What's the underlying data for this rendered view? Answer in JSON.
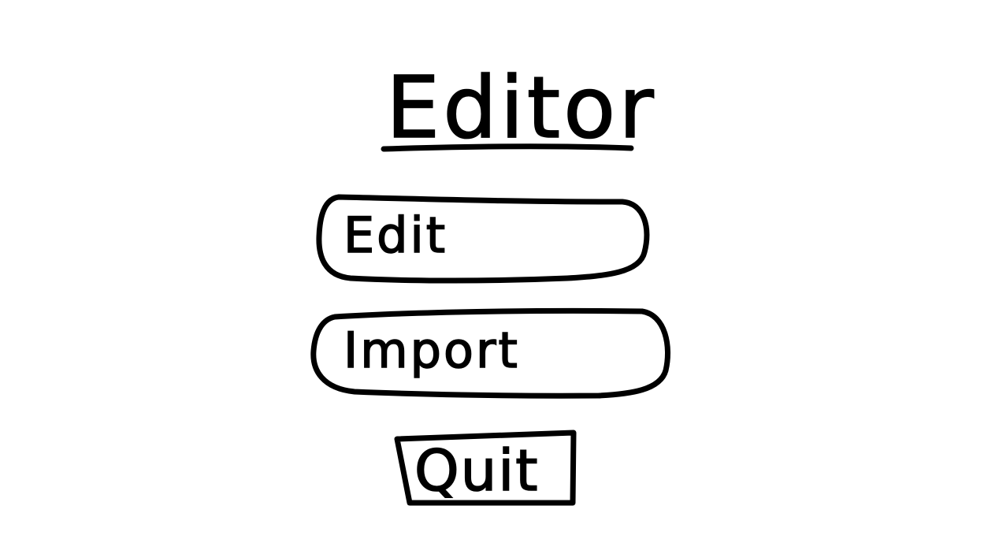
{
  "header": {
    "title": "Editor"
  },
  "menu": {
    "edit_label": "Edit",
    "import_label": "Import",
    "quit_label": "Quit"
  }
}
